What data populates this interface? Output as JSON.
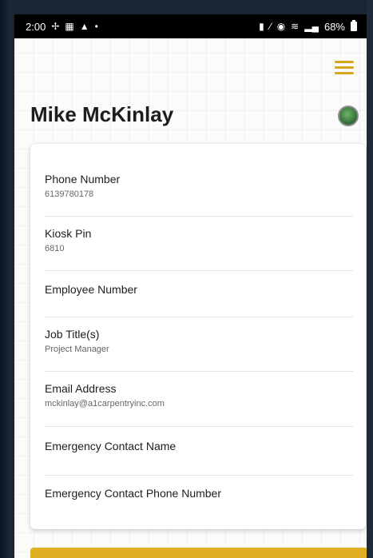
{
  "status_bar": {
    "time": "2:00",
    "battery": "68%"
  },
  "profile": {
    "name": "Mike McKinlay"
  },
  "fields": [
    {
      "label": "Phone Number",
      "value": "6139780178"
    },
    {
      "label": "Kiosk Pin",
      "value": "6810"
    },
    {
      "label": "Employee Number",
      "value": ""
    },
    {
      "label": "Job Title(s)",
      "value": "Project Manager"
    },
    {
      "label": "Email Address",
      "value": "mckinlay@a1carpentryinc.com"
    },
    {
      "label": "Emergency Contact Name",
      "value": ""
    },
    {
      "label": "Emergency Contact Phone Number",
      "value": ""
    }
  ],
  "colors": {
    "accent": "#e1b022",
    "menu": "#d4a81e",
    "status_bar": "#000000"
  }
}
